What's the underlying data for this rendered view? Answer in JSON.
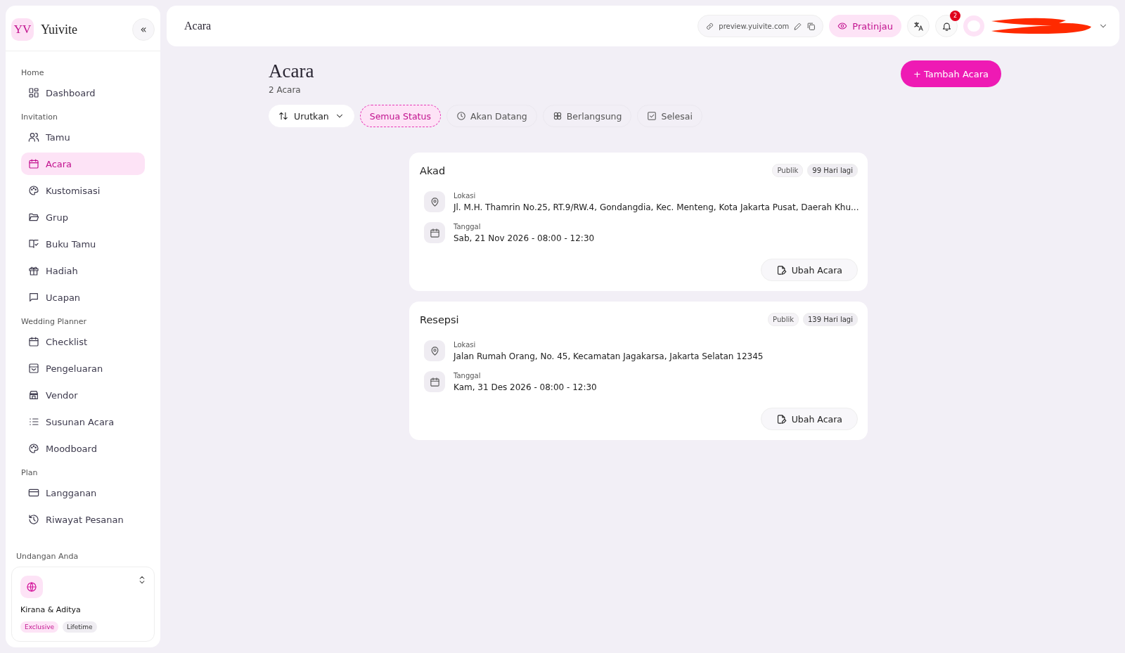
{
  "brand": {
    "logo": "YV",
    "name": "Yuivite",
    "collapse": "«"
  },
  "sidebar": {
    "sections": [
      {
        "title": "Home",
        "items": [
          {
            "label": "Dashboard",
            "selected": false
          }
        ]
      },
      {
        "title": "Invitation",
        "items": [
          {
            "label": "Tamu",
            "selected": false
          },
          {
            "label": "Acara",
            "selected": true
          },
          {
            "label": "Kustomisasi",
            "selected": false
          },
          {
            "label": "Grup",
            "selected": false
          },
          {
            "label": "Buku Tamu",
            "selected": false
          },
          {
            "label": "Hadiah",
            "selected": false
          },
          {
            "label": "Ucapan",
            "selected": false
          }
        ]
      },
      {
        "title": "Wedding Planner",
        "items": [
          {
            "label": "Checklist",
            "selected": false
          },
          {
            "label": "Pengeluaran",
            "selected": false
          },
          {
            "label": "Vendor",
            "selected": false
          },
          {
            "label": "Susunan Acara",
            "selected": false
          },
          {
            "label": "Moodboard",
            "selected": false
          }
        ]
      },
      {
        "title": "Plan",
        "items": [
          {
            "label": "Langganan",
            "selected": false
          },
          {
            "label": "Riwayat Pesanan",
            "selected": false
          }
        ]
      }
    ],
    "invitation": {
      "heading": "Undangan Anda",
      "name": "Kirana & Aditya",
      "tags": [
        {
          "label": "Exclusive",
          "kind": "accent"
        },
        {
          "label": "Lifetime",
          "kind": "plain"
        }
      ]
    }
  },
  "topbar": {
    "title": "Acara",
    "url": "preview.yuivite.com",
    "preview": "Pratinjau",
    "notifications": "2"
  },
  "page": {
    "title": "Acara",
    "count": "2 Acara",
    "add_button": "+ Tambah Acara",
    "sort": "Urutkan",
    "filters": [
      {
        "label": "Semua Status",
        "selected": true
      },
      {
        "label": "Akan Datang",
        "selected": false
      },
      {
        "label": "Berlangsung",
        "selected": false
      },
      {
        "label": "Selesai",
        "selected": false
      }
    ]
  },
  "events": [
    {
      "name": "Akad",
      "visibility": "Publik",
      "countdown": "99 Hari lagi",
      "location_label": "Lokasi",
      "location": "Jl. M.H. Thamrin No.25, RT.9/RW.4, Gondangdia, Kec. Menteng, Kota Jakarta Pusat, Daerah Khu...",
      "date_label": "Tanggal",
      "date": "Sab, 21 Nov 2026 - 08:00 - 12:30",
      "edit": "Ubah Acara"
    },
    {
      "name": "Resepsi",
      "visibility": "Publik",
      "countdown": "139 Hari lagi",
      "location_label": "Lokasi",
      "location": "Jalan Rumah Orang, No. 45, Kecamatan Jagakarsa, Jakarta Selatan 12345",
      "date_label": "Tanggal",
      "date": "Kam, 31 Des 2026 - 08:00 - 12:30",
      "edit": "Ubah Acara"
    }
  ]
}
